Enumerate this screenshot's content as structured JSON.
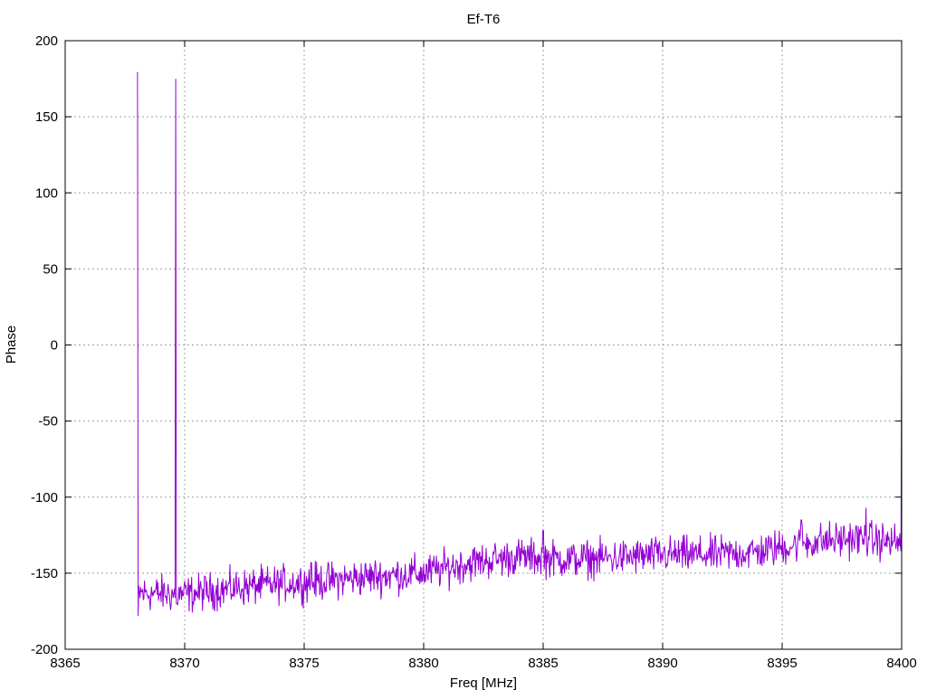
{
  "chart_data": {
    "type": "line",
    "title": "Ef-T6",
    "xlabel": "Freq [MHz]",
    "ylabel": "Phase",
    "xlim": [
      8365,
      8400
    ],
    "ylim": [
      -200,
      200
    ],
    "x_ticks": [
      8365,
      8370,
      8375,
      8380,
      8385,
      8390,
      8395,
      8400
    ],
    "x_tick_labels": [
      "8365",
      "8370",
      "8375",
      "8380",
      "8385",
      "8390",
      "8395",
      "8400"
    ],
    "y_ticks": [
      -200,
      -150,
      -100,
      -50,
      0,
      50,
      100,
      150,
      200
    ],
    "y_tick_labels": [
      "-200",
      "-150",
      "-100",
      "-50",
      "0",
      "50",
      "100",
      "150",
      "200"
    ],
    "grid": true,
    "colors": {
      "series": "#9400d3",
      "grid": "#a0a0a0",
      "axis": "#000000"
    },
    "series": [
      {
        "x_start": 8368.0,
        "x_end": 8400.0,
        "approx_points": 1200,
        "trend_points": [
          [
            8368.0,
            -163
          ],
          [
            8370.0,
            -164
          ],
          [
            8372.0,
            -160
          ],
          [
            8374.0,
            -157
          ],
          [
            8376.0,
            -155
          ],
          [
            8378.0,
            -152
          ],
          [
            8380.0,
            -150
          ],
          [
            8382.0,
            -143
          ],
          [
            8384.0,
            -139
          ],
          [
            8386.0,
            -141
          ],
          [
            8388.0,
            -140
          ],
          [
            8390.0,
            -138
          ],
          [
            8392.0,
            -138
          ],
          [
            8394.0,
            -136
          ],
          [
            8396.0,
            -130
          ],
          [
            8398.0,
            -127
          ],
          [
            8399.9,
            -130
          ]
        ],
        "spikes": [
          {
            "x": 8368.0,
            "top": 179,
            "bottom": -178
          },
          {
            "x": 8369.62,
            "top": 175,
            "bottom": -170
          },
          {
            "x": 8399.98,
            "top": 9,
            "bottom": -160
          }
        ],
        "notable_peaks": [
          {
            "x": 8375.3,
            "y": -143
          },
          {
            "x": 8385.0,
            "y": -122
          },
          {
            "x": 8395.8,
            "y": -115
          },
          {
            "x": 8398.5,
            "y": -107
          }
        ],
        "noise_amplitude": 6
      }
    ]
  }
}
